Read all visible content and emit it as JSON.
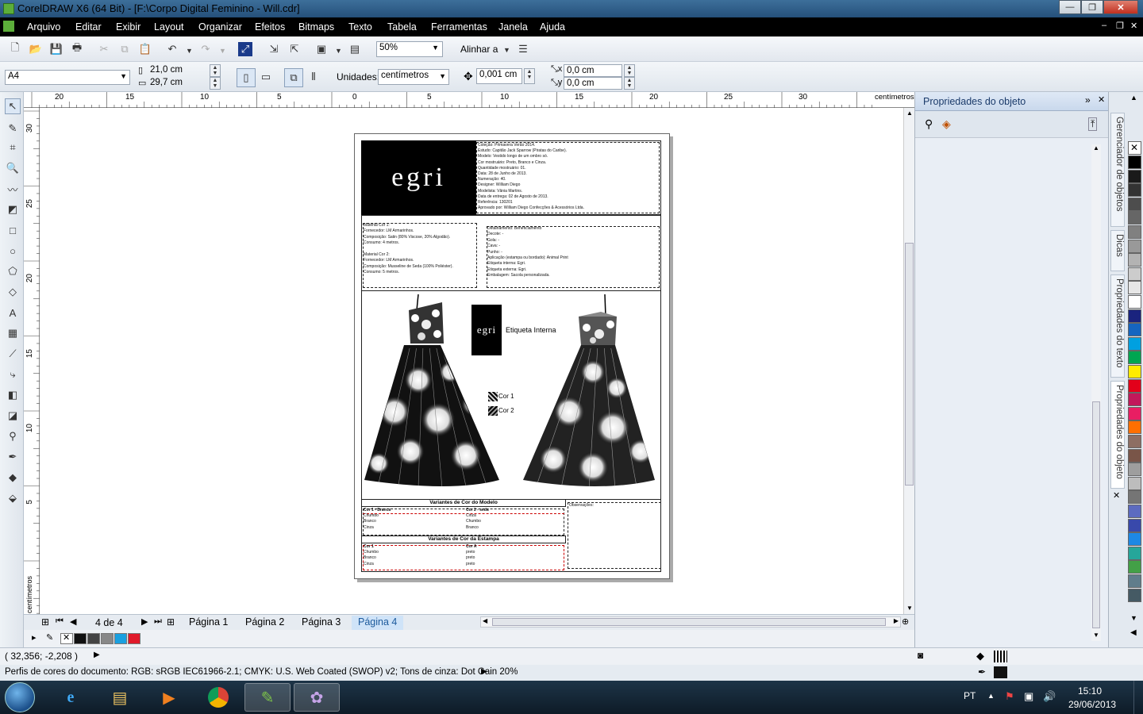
{
  "window": {
    "title": "CorelDRAW X6 (64 Bit) - [F:\\Corpo Digital Feminino - Will.cdr]",
    "min_label": "—",
    "max_label": "❐",
    "close_label": "✕"
  },
  "menu": [
    "Arquivo",
    "Editar",
    "Exibir",
    "Layout",
    "Organizar",
    "Efeitos",
    "Bitmaps",
    "Texto",
    "Tabela",
    "Ferramentas",
    "Janela",
    "Ajuda"
  ],
  "toolbar": {
    "zoom": "50%",
    "align_label": "Alinhar a"
  },
  "propertybar": {
    "page_size": "A4",
    "width": "21,0 cm",
    "height": "29,7 cm",
    "units_label": "Unidades:",
    "units_value": "centímetros",
    "nudge": "0,001 cm",
    "dup_x": "0,0 cm",
    "dup_y": "0,0 cm"
  },
  "ruler": {
    "h_ticks": [
      "20",
      "15",
      "10",
      "5",
      "0",
      "5",
      "10",
      "15",
      "20",
      "25",
      "30"
    ],
    "h_unit": "centímetros",
    "v_ticks": [
      "30",
      "25",
      "20",
      "15",
      "10",
      "5"
    ],
    "v_unit": "centímetros"
  },
  "pages": {
    "counter": "4 de 4",
    "tabs": [
      "Página 1",
      "Página 2",
      "Página 3",
      "Página 4"
    ]
  },
  "status": {
    "coords": "( 32,356; -2,208 )",
    "profiles": "Perfis de cores do documento: RGB: sRGB IEC61966-2.1; CMYK: U.S. Web Coated (SWOP) v2; Tons de cinza: Dot Gain 20%"
  },
  "docker": {
    "title": "Propriedades do objeto",
    "tabs": [
      "Gerenciador de objetos",
      "Dicas",
      "Propriedades do texto",
      "Propriedades do objeto"
    ]
  },
  "palette_bottom": [
    "#111111",
    "#444444",
    "#888888",
    "#1aa0e0",
    "#e01a2a"
  ],
  "palette_right": [
    "#000000",
    "#1a1a1a",
    "#333333",
    "#4d4d4d",
    "#666666",
    "#808080",
    "#999999",
    "#b3b3b3",
    "#cccccc",
    "#e6e6e6",
    "#ffffff",
    "#1a237e",
    "#1565c0",
    "#00a0e0",
    "#00a651",
    "#ffeb00",
    "#e2001a",
    "#c2185b",
    "#e91e63",
    "#ff6f00",
    "#8d6e63",
    "#795548",
    "#9e9e9e",
    "#bdbdbd",
    "#757575",
    "#5c6bc0",
    "#3949ab",
    "#1e88e5",
    "#26a69a",
    "#43a047",
    "#607d8b",
    "#455a64"
  ],
  "taskbar": {
    "lang": "PT",
    "time": "15:10",
    "date": "29/06/2013"
  },
  "sheet": {
    "brand": "egri",
    "header_lines": [
      "Coleção: Primavera Verão 2014.",
      "Estudo: Capitão Jack Sparrow (Piratas do Caribe).",
      "Modelo: Vestido longo de um ombro só.",
      "Cor mostruário: Preto, Branco e Cinza.",
      "Quantidade mostruário: 01.",
      "Data: 28 de Junho de 2013.",
      "Numeração: 40.",
      "Designer: William Diego",
      "Modelista: Vânia Martins.",
      "Data de entrega: 02 de Agosto de 2013.",
      "Referência: 130201",
      "Aprovado por: William Diego Confecções & Acessórios Ltda."
    ],
    "material_lines": [
      "Material Cor 1:",
      "Fornecedor: LM Armarinhos.",
      "Composição: Satin (80% Viscose, 20% Algodão).",
      "Consumo: 4 metros.",
      "",
      "Material Cor 2:",
      "Fornecedor: LM Armarinhos.",
      "Composição: Musseline de Seda (100% Poliéster).",
      "Consumo: 5 metros."
    ],
    "details_lines": [
      "Detalhamento: Beneficiamento",
      "Decote: -",
      "Gola: -",
      "Cava: -",
      "Punho: -",
      "Aplicação (estampa ou bordado): Animal Print",
      "Etiqueta interna: Egri.",
      "Etiqueta externa: Egri.",
      "Embalagem: Sacola personalizada."
    ],
    "label_caption": "Etiqueta Interna",
    "cor1": "Cor 1",
    "cor2": "Cor 2",
    "variants_model_title": "Variantes de Cor do Modelo",
    "variants_print_title": "Variantes de Cor da Estampa",
    "observacoes": "Observações:",
    "model_col1": [
      "Cor 1 - Branca",
      "Chumbo",
      "Branco",
      "Cinza"
    ],
    "model_col2": [
      "Cor 2 - seda",
      "Cinza",
      "Chumbo",
      "Branco"
    ],
    "print_col1": [
      "Cor 1",
      "Chumbo",
      "Branco",
      "Cinza"
    ],
    "print_col2": [
      "Cor A",
      "preto",
      "preto",
      "preto"
    ]
  }
}
